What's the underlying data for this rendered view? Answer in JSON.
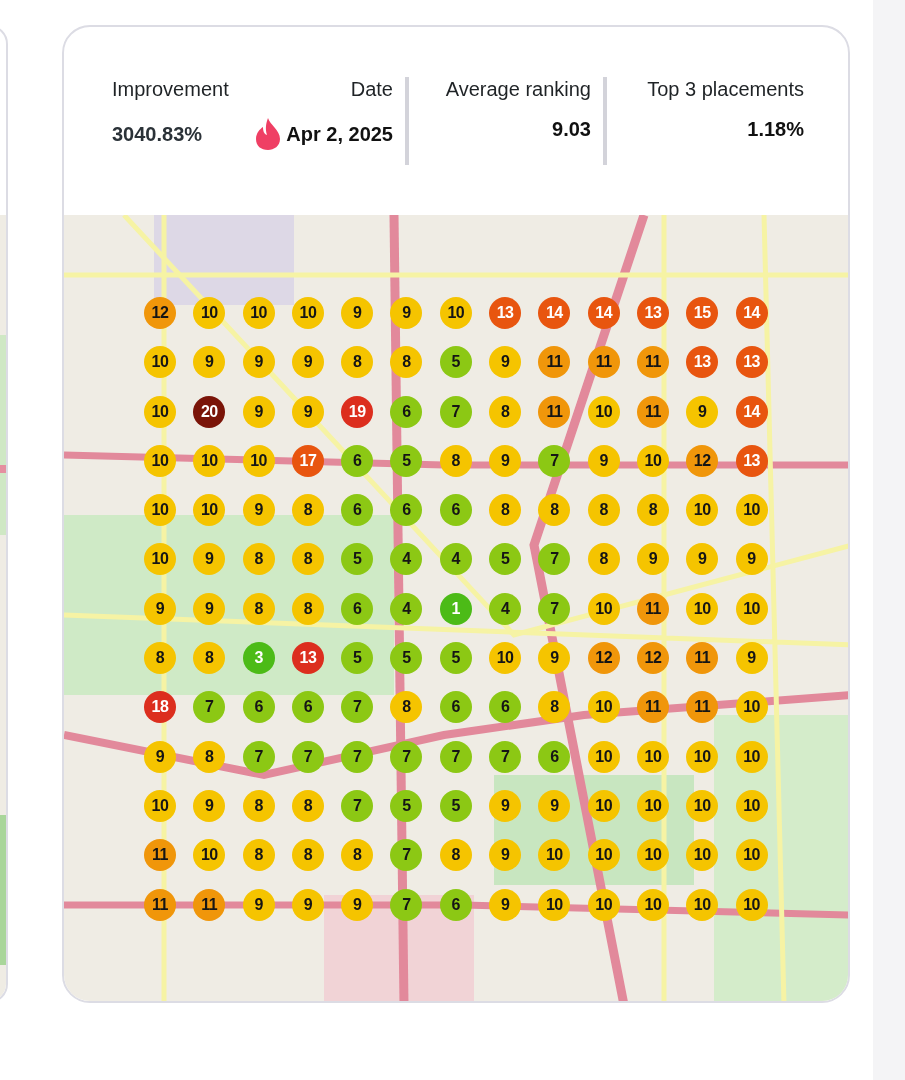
{
  "header": {
    "improvement": {
      "label": "Improvement",
      "value": "3040.83%"
    },
    "date": {
      "label": "Date",
      "value": "Apr 2, 2025"
    },
    "stats": [
      {
        "label": "Average ranking",
        "value": "9.03"
      },
      {
        "label": "Top 3 placements",
        "value": "1.18%"
      }
    ]
  },
  "map": {
    "pins": [
      [
        {
          "rank": "12",
          "color": "#f0960a"
        },
        {
          "rank": "10",
          "color": "#f5c400"
        },
        {
          "rank": "10",
          "color": "#f5c400"
        },
        {
          "rank": "10",
          "color": "#f5c400"
        },
        {
          "rank": "9",
          "color": "#f5c400"
        },
        {
          "rank": "9",
          "color": "#f5c400"
        },
        {
          "rank": "10",
          "color": "#f5c400"
        },
        {
          "rank": "13",
          "color": "#e8550f"
        },
        {
          "rank": "14",
          "color": "#e8550f"
        },
        {
          "rank": "14",
          "color": "#e8550f"
        },
        {
          "rank": "13",
          "color": "#e8550f"
        },
        {
          "rank": "15",
          "color": "#e8550f"
        },
        {
          "rank": "14",
          "color": "#e8550f"
        }
      ],
      [
        {
          "rank": "10",
          "color": "#f5c400"
        },
        {
          "rank": "9",
          "color": "#f5c400"
        },
        {
          "rank": "9",
          "color": "#f5c400"
        },
        {
          "rank": "9",
          "color": "#f5c400"
        },
        {
          "rank": "8",
          "color": "#f5c400"
        },
        {
          "rank": "8",
          "color": "#f5c400"
        },
        {
          "rank": "5",
          "color": "#8cc814"
        },
        {
          "rank": "9",
          "color": "#f5c400"
        },
        {
          "rank": "11",
          "color": "#f0960a"
        },
        {
          "rank": "11",
          "color": "#f0960a"
        },
        {
          "rank": "11",
          "color": "#f0960a"
        },
        {
          "rank": "13",
          "color": "#e8550f"
        },
        {
          "rank": "13",
          "color": "#e8550f"
        }
      ],
      [
        {
          "rank": "10",
          "color": "#f5c400"
        },
        {
          "rank": "20",
          "color": "#7a1408"
        },
        {
          "rank": "9",
          "color": "#f5c400"
        },
        {
          "rank": "9",
          "color": "#f5c400"
        },
        {
          "rank": "19",
          "color": "#dc2e1e"
        },
        {
          "rank": "6",
          "color": "#8cc814"
        },
        {
          "rank": "7",
          "color": "#8cc814"
        },
        {
          "rank": "8",
          "color": "#f5c400"
        },
        {
          "rank": "11",
          "color": "#f0960a"
        },
        {
          "rank": "10",
          "color": "#f5c400"
        },
        {
          "rank": "11",
          "color": "#f0960a"
        },
        {
          "rank": "9",
          "color": "#f5c400"
        },
        {
          "rank": "14",
          "color": "#e8550f"
        }
      ],
      [
        {
          "rank": "10",
          "color": "#f5c400"
        },
        {
          "rank": "10",
          "color": "#f5c400"
        },
        {
          "rank": "10",
          "color": "#f5c400"
        },
        {
          "rank": "17",
          "color": "#e8550f"
        },
        {
          "rank": "6",
          "color": "#8cc814"
        },
        {
          "rank": "5",
          "color": "#8cc814"
        },
        {
          "rank": "8",
          "color": "#f5c400"
        },
        {
          "rank": "9",
          "color": "#f5c400"
        },
        {
          "rank": "7",
          "color": "#8cc814"
        },
        {
          "rank": "9",
          "color": "#f5c400"
        },
        {
          "rank": "10",
          "color": "#f5c400"
        },
        {
          "rank": "12",
          "color": "#f0960a"
        },
        {
          "rank": "13",
          "color": "#e8550f"
        }
      ],
      [
        {
          "rank": "10",
          "color": "#f5c400"
        },
        {
          "rank": "10",
          "color": "#f5c400"
        },
        {
          "rank": "9",
          "color": "#f5c400"
        },
        {
          "rank": "8",
          "color": "#f5c400"
        },
        {
          "rank": "6",
          "color": "#8cc814"
        },
        {
          "rank": "6",
          "color": "#8cc814"
        },
        {
          "rank": "6",
          "color": "#8cc814"
        },
        {
          "rank": "8",
          "color": "#f5c400"
        },
        {
          "rank": "8",
          "color": "#f5c400"
        },
        {
          "rank": "8",
          "color": "#f5c400"
        },
        {
          "rank": "8",
          "color": "#f5c400"
        },
        {
          "rank": "10",
          "color": "#f5c400"
        },
        {
          "rank": "10",
          "color": "#f5c400"
        }
      ],
      [
        {
          "rank": "10",
          "color": "#f5c400"
        },
        {
          "rank": "9",
          "color": "#f5c400"
        },
        {
          "rank": "8",
          "color": "#f5c400"
        },
        {
          "rank": "8",
          "color": "#f5c400"
        },
        {
          "rank": "5",
          "color": "#8cc814"
        },
        {
          "rank": "4",
          "color": "#8cc814"
        },
        {
          "rank": "4",
          "color": "#8cc814"
        },
        {
          "rank": "5",
          "color": "#8cc814"
        },
        {
          "rank": "7",
          "color": "#8cc814"
        },
        {
          "rank": "8",
          "color": "#f5c400"
        },
        {
          "rank": "9",
          "color": "#f5c400"
        },
        {
          "rank": "9",
          "color": "#f5c400"
        },
        {
          "rank": "9",
          "color": "#f5c400"
        }
      ],
      [
        {
          "rank": "9",
          "color": "#f5c400"
        },
        {
          "rank": "9",
          "color": "#f5c400"
        },
        {
          "rank": "8",
          "color": "#f5c400"
        },
        {
          "rank": "8",
          "color": "#f5c400"
        },
        {
          "rank": "6",
          "color": "#8cc814"
        },
        {
          "rank": "4",
          "color": "#8cc814"
        },
        {
          "rank": "1",
          "color": "#4cbb17"
        },
        {
          "rank": "4",
          "color": "#8cc814"
        },
        {
          "rank": "7",
          "color": "#8cc814"
        },
        {
          "rank": "10",
          "color": "#f5c400"
        },
        {
          "rank": "11",
          "color": "#f0960a"
        },
        {
          "rank": "10",
          "color": "#f5c400"
        },
        {
          "rank": "10",
          "color": "#f5c400"
        }
      ],
      [
        {
          "rank": "8",
          "color": "#f5c400"
        },
        {
          "rank": "8",
          "color": "#f5c400"
        },
        {
          "rank": "3",
          "color": "#4cbb17"
        },
        {
          "rank": "13",
          "color": "#dc2e1e"
        },
        {
          "rank": "5",
          "color": "#8cc814"
        },
        {
          "rank": "5",
          "color": "#8cc814"
        },
        {
          "rank": "5",
          "color": "#8cc814"
        },
        {
          "rank": "10",
          "color": "#f5c400"
        },
        {
          "rank": "9",
          "color": "#f5c400"
        },
        {
          "rank": "12",
          "color": "#f0960a"
        },
        {
          "rank": "12",
          "color": "#f0960a"
        },
        {
          "rank": "11",
          "color": "#f0960a"
        },
        {
          "rank": "9",
          "color": "#f5c400"
        }
      ],
      [
        {
          "rank": "18",
          "color": "#dc2e1e"
        },
        {
          "rank": "7",
          "color": "#8cc814"
        },
        {
          "rank": "6",
          "color": "#8cc814"
        },
        {
          "rank": "6",
          "color": "#8cc814"
        },
        {
          "rank": "7",
          "color": "#8cc814"
        },
        {
          "rank": "8",
          "color": "#f5c400"
        },
        {
          "rank": "6",
          "color": "#8cc814"
        },
        {
          "rank": "6",
          "color": "#8cc814"
        },
        {
          "rank": "8",
          "color": "#f5c400"
        },
        {
          "rank": "10",
          "color": "#f5c400"
        },
        {
          "rank": "11",
          "color": "#f0960a"
        },
        {
          "rank": "11",
          "color": "#f0960a"
        },
        {
          "rank": "10",
          "color": "#f5c400"
        }
      ],
      [
        {
          "rank": "9",
          "color": "#f5c400"
        },
        {
          "rank": "8",
          "color": "#f5c400"
        },
        {
          "rank": "7",
          "color": "#8cc814"
        },
        {
          "rank": "7",
          "color": "#8cc814"
        },
        {
          "rank": "7",
          "color": "#8cc814"
        },
        {
          "rank": "7",
          "color": "#8cc814"
        },
        {
          "rank": "7",
          "color": "#8cc814"
        },
        {
          "rank": "7",
          "color": "#8cc814"
        },
        {
          "rank": "6",
          "color": "#8cc814"
        },
        {
          "rank": "10",
          "color": "#f5c400"
        },
        {
          "rank": "10",
          "color": "#f5c400"
        },
        {
          "rank": "10",
          "color": "#f5c400"
        },
        {
          "rank": "10",
          "color": "#f5c400"
        }
      ],
      [
        {
          "rank": "10",
          "color": "#f5c400"
        },
        {
          "rank": "9",
          "color": "#f5c400"
        },
        {
          "rank": "8",
          "color": "#f5c400"
        },
        {
          "rank": "8",
          "color": "#f5c400"
        },
        {
          "rank": "7",
          "color": "#8cc814"
        },
        {
          "rank": "5",
          "color": "#8cc814"
        },
        {
          "rank": "5",
          "color": "#8cc814"
        },
        {
          "rank": "9",
          "color": "#f5c400"
        },
        {
          "rank": "9",
          "color": "#f5c400"
        },
        {
          "rank": "10",
          "color": "#f5c400"
        },
        {
          "rank": "10",
          "color": "#f5c400"
        },
        {
          "rank": "10",
          "color": "#f5c400"
        },
        {
          "rank": "10",
          "color": "#f5c400"
        }
      ],
      [
        {
          "rank": "11",
          "color": "#f0960a"
        },
        {
          "rank": "10",
          "color": "#f5c400"
        },
        {
          "rank": "8",
          "color": "#f5c400"
        },
        {
          "rank": "8",
          "color": "#f5c400"
        },
        {
          "rank": "8",
          "color": "#f5c400"
        },
        {
          "rank": "7",
          "color": "#8cc814"
        },
        {
          "rank": "8",
          "color": "#f5c400"
        },
        {
          "rank": "9",
          "color": "#f5c400"
        },
        {
          "rank": "10",
          "color": "#f5c400"
        },
        {
          "rank": "10",
          "color": "#f5c400"
        },
        {
          "rank": "10",
          "color": "#f5c400"
        },
        {
          "rank": "10",
          "color": "#f5c400"
        },
        {
          "rank": "10",
          "color": "#f5c400"
        }
      ],
      [
        {
          "rank": "11",
          "color": "#f0960a"
        },
        {
          "rank": "11",
          "color": "#f0960a"
        },
        {
          "rank": "9",
          "color": "#f5c400"
        },
        {
          "rank": "9",
          "color": "#f5c400"
        },
        {
          "rank": "9",
          "color": "#f5c400"
        },
        {
          "rank": "7",
          "color": "#8cc814"
        },
        {
          "rank": "6",
          "color": "#8cc814"
        },
        {
          "rank": "9",
          "color": "#f5c400"
        },
        {
          "rank": "10",
          "color": "#f5c400"
        },
        {
          "rank": "10",
          "color": "#f5c400"
        },
        {
          "rank": "10",
          "color": "#f5c400"
        },
        {
          "rank": "10",
          "color": "#f5c400"
        },
        {
          "rank": "10",
          "color": "#f5c400"
        }
      ]
    ]
  }
}
